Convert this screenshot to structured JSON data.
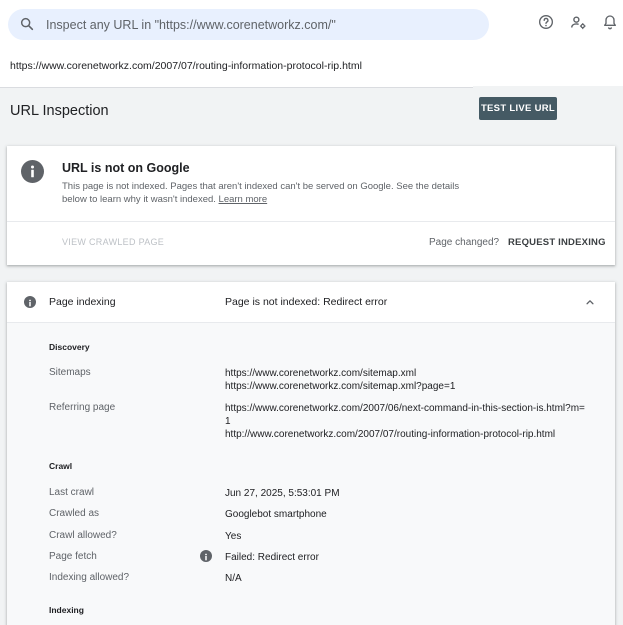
{
  "search": {
    "placeholder": "Inspect any URL in \"https://www.corenetworkz.com/\"",
    "value": ""
  },
  "header_icons": [
    "help-icon",
    "manage-accounts-icon",
    "notifications-icon"
  ],
  "inspected_url": "https://www.corenetworkz.com/2007/07/routing-information-protocol-rip.html",
  "page_title": "URL Inspection",
  "test_live_label": "TEST LIVE URL",
  "status": {
    "title": "URL is not on Google",
    "description": "This page is not indexed. Pages that aren't indexed can't be served on Google. See the details below to learn why it wasn't indexed.",
    "learn_more": "Learn more",
    "view_crawled": "VIEW CRAWLED PAGE",
    "page_changed": "Page changed?",
    "request_indexing": "REQUEST INDEXING"
  },
  "page_indexing": {
    "label": "Page indexing",
    "status": "Page is not indexed: Redirect error",
    "discovery": {
      "heading": "Discovery",
      "sitemaps_label": "Sitemaps",
      "sitemaps": [
        "https://www.corenetworkz.com/sitemap.xml",
        "https://www.corenetworkz.com/sitemap.xml?page=1"
      ],
      "referring_label": "Referring page",
      "referring": [
        "https://www.corenetworkz.com/2007/06/next-command-in-this-section-is.html?m=",
        "1",
        "http://www.corenetworkz.com/2007/07/routing-information-protocol-rip.html"
      ]
    },
    "crawl": {
      "heading": "Crawl",
      "last_crawl_label": "Last crawl",
      "last_crawl": "Jun 27, 2025, 5:53:01 PM",
      "crawled_as_label": "Crawled as",
      "crawled_as": "Googlebot smartphone",
      "crawl_allowed_label": "Crawl allowed?",
      "crawl_allowed": "Yes",
      "page_fetch_label": "Page fetch",
      "page_fetch": "Failed: Redirect error",
      "indexing_allowed_label": "Indexing allowed?",
      "indexing_allowed": "N/A"
    },
    "indexing": {
      "heading": "Indexing"
    }
  }
}
